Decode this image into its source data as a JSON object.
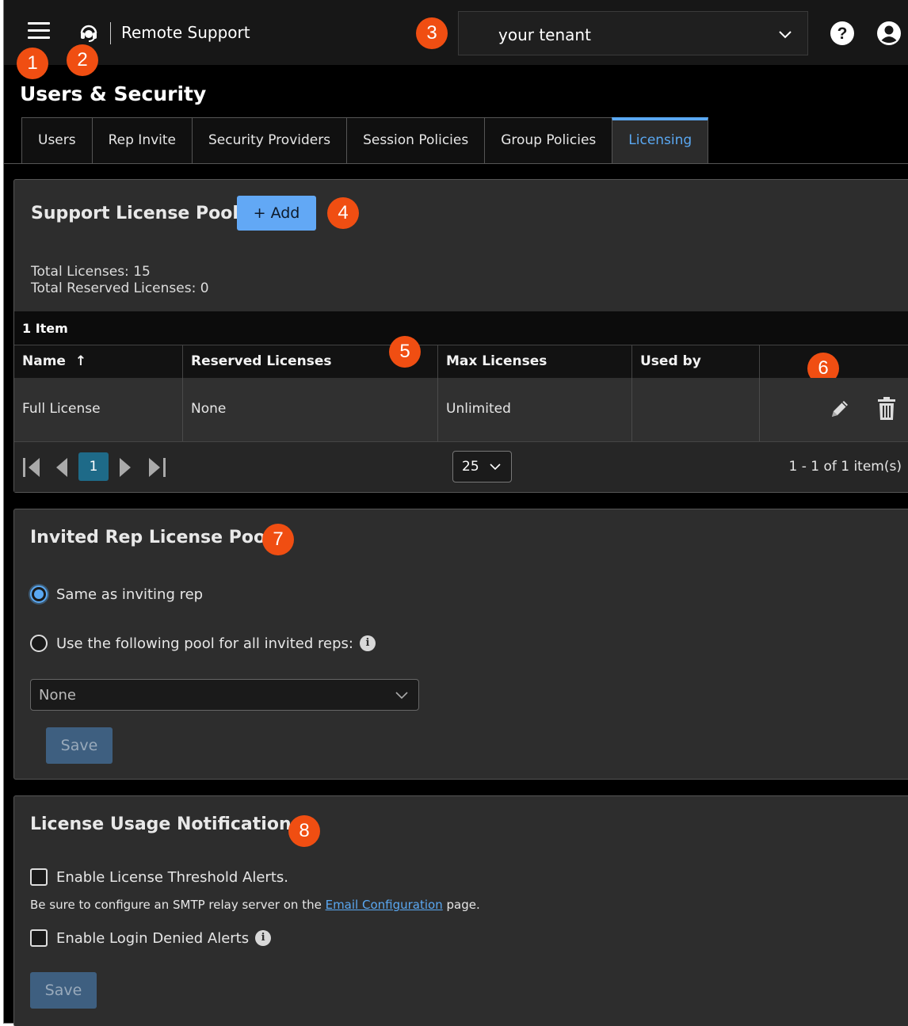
{
  "topbar": {
    "app_name": "Remote Support",
    "tenant": "your tenant"
  },
  "badges": [
    "1",
    "2",
    "3",
    "4",
    "5",
    "6",
    "7",
    "8"
  ],
  "page_title": "Users & Security",
  "tabs": [
    {
      "label": "Users",
      "active": false
    },
    {
      "label": "Rep Invite",
      "active": false
    },
    {
      "label": "Security Providers",
      "active": false
    },
    {
      "label": "Session Policies",
      "active": false
    },
    {
      "label": "Group Policies",
      "active": false
    },
    {
      "label": "Licensing",
      "active": true
    }
  ],
  "support_pools": {
    "title": "Support License Pools",
    "add_label": "Add",
    "total_licenses_label": "Total Licenses:",
    "total_licenses": "15",
    "total_reserved_label": "Total Reserved Licenses:",
    "total_reserved": "0",
    "items_count": "1 Item",
    "columns": [
      "Name",
      "Reserved Licenses",
      "Max Licenses",
      "Used by",
      ""
    ],
    "rows": [
      {
        "name": "Full License",
        "reserved": "None",
        "max": "Unlimited",
        "used_by": ""
      }
    ],
    "pager": {
      "current_page": "1",
      "page_size": "25",
      "info": "1 - 1 of 1 item(s)"
    }
  },
  "invited_pool": {
    "title": "Invited Rep License Pool",
    "option_same": "Same as inviting rep",
    "option_following": "Use the following pool for all invited reps:",
    "selected_option": "same",
    "pool_value": "None",
    "save_label": "Save"
  },
  "usage_notification": {
    "title": "License Usage Notification",
    "threshold_label": "Enable License Threshold Alerts.",
    "note_prefix": "Be sure to configure an SMTP relay server on the",
    "note_link": "Email Configuration",
    "note_suffix": "page.",
    "denied_label": "Enable Login Denied Alerts",
    "save_label": "Save"
  },
  "colors": {
    "accent": "#5aa8f2",
    "badge": "#f04e12",
    "panel_bg": "#2d2d2d"
  }
}
